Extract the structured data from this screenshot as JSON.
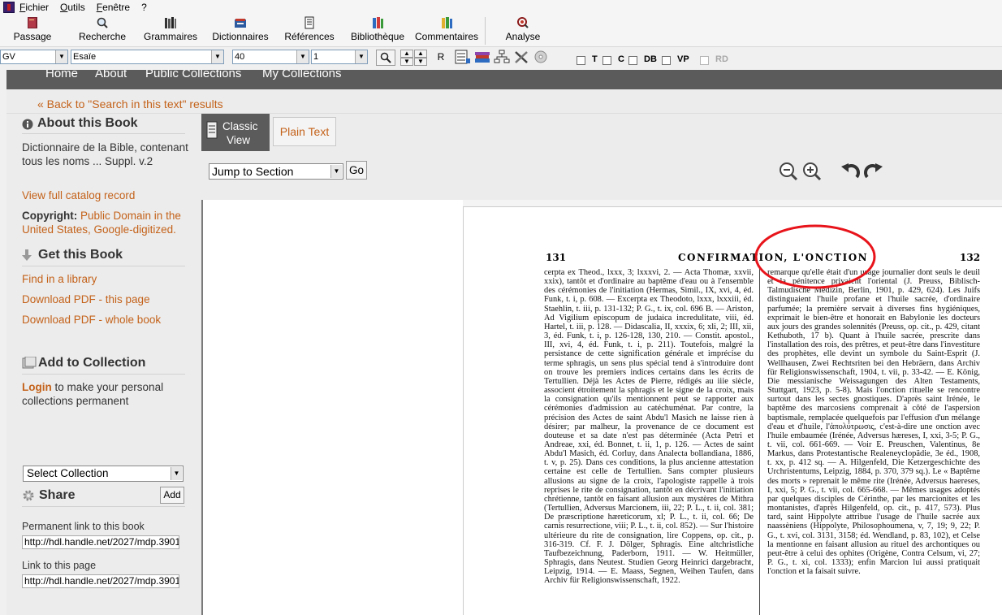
{
  "menu": [
    "Fichier",
    "Outils",
    "Fenêtre",
    "?"
  ],
  "toolbar": [
    {
      "label": "Passage",
      "icon": "book-passage-icon"
    },
    {
      "label": "Recherche",
      "icon": "search-icon"
    },
    {
      "label": "Grammaires",
      "icon": "grammar-books-icon"
    },
    {
      "label": "Dictionnaires",
      "icon": "dictionary-icon"
    },
    {
      "label": "Références",
      "icon": "references-icon"
    },
    {
      "label": "Bibliothèque",
      "icon": "library-icon"
    },
    {
      "label": "Commentaires",
      "icon": "commentary-books-icon"
    },
    {
      "label": "Analyse",
      "icon": "analysis-magnifier-icon"
    }
  ],
  "selectors": {
    "version": "GV",
    "book": "Esaïe",
    "chapter": "40",
    "verse": "1"
  },
  "row2_buttons": {
    "r_label": "R"
  },
  "checkboxes": [
    {
      "label": "T",
      "enabled": true
    },
    {
      "label": "C",
      "enabled": true
    },
    {
      "label": "DB",
      "enabled": true
    },
    {
      "label": "VP",
      "enabled": true
    },
    {
      "label": "RD",
      "enabled": false
    }
  ],
  "web": {
    "nav": [
      "Home",
      "About",
      "Public Collections",
      "My Collections"
    ],
    "back_link": "« Back to \"Search in this text\" results",
    "about": {
      "heading": "About this Book",
      "title": "Dictionnaire de la Bible, contenant tous les noms ... Suppl. v.2",
      "catalog_link": "View full catalog record",
      "copyright_label": "Copyright:",
      "copyright_value": "Public Domain in the United States, Google-digitized."
    },
    "get_book": {
      "heading": "Get this Book",
      "links": [
        "Find in a library",
        "Download PDF - this page",
        "Download PDF - whole book"
      ]
    },
    "collection": {
      "heading": "Add to Collection",
      "login_word": "Login",
      "login_rest": " to make your personal collections permanent",
      "select_value": "Select Collection",
      "add_label": "Add"
    },
    "share": {
      "heading": "Share",
      "permanent_label": "Permanent link to this book",
      "permanent_value": "http://hdl.handle.net/2027/mdp.3901",
      "page_label": "Link to this page",
      "page_value": "http://hdl.handle.net/2027/mdp.3901"
    },
    "views": {
      "classic_line1": "Classic",
      "classic_line2": "View",
      "plain": "Plain Text"
    },
    "jump": {
      "value": "Jump to Section",
      "go_label": "Go"
    },
    "page": {
      "left_num": "131",
      "running_title": "CONFIRMATION, L'ONCTION",
      "right_num": "132",
      "col_left": "cerpta ex Theod., lxxx, 3; lxxxvi, 2. — Acta Thomæ, xxvii, xxix), tantôt et d'ordinaire au baptême d'eau ou à l'ensemble des cérémonies de l'initiation (Hermas, Simil., IX, xvi, 4, éd. Funk, t. i, p. 608. — Excerpta ex Theodoto, lxxx, lxxxiii, éd. Staehlin, t. iii, p. 131-132; P. G., t. ix, col. 696 B. — Ariston, Ad Vigilium episcopum de judaica incredulitate, viii, éd. Hartel, t. iii, p. 128. — Didascalia, II, xxxix, 6; xli, 2; III, xii, 3, éd. Funk, t. i, p. 126-128, 130, 210. — Constit. apostol., III, xvi, 4, éd. Funk, t. i, p. 211). Toutefois, malgré la persistance de cette signification générale et imprécise du terme sphragis, un sens plus spécial tend à s'introduire dont on trouve les premiers indices certains dans les écrits de Tertullien. Déjà les Actes de Pierre, rédigés au iiie siècle, associent étroitement la sphragis et le signe de la croix, mais la consignation qu'ils mentionnent peut se rapporter aux cérémonies d'admission au catéchuménat. Par contre, la précision des Actes de saint Abdu'l Masich ne laisse rien à désirer; par malheur, la provenance de ce document est douteuse et sa date n'est pas déterminée (Acta Petri et Andreae, xxi, éd. Bonnet, t. ii, 1, p. 126. — Actes de saint Abdu'l Masich, éd. Corluy, dans Analecta bollandiana, 1886, t. v, p. 25). Dans ces conditions, la plus ancienne attestation certaine est celle de Tertullien. Sans compter plusieurs allusions au signe de la croix, l'apologiste rappelle à trois reprises le rite de consignation, tantôt en décrivant l'initiation chrétienne, tantôt en faisant allusion aux mystères de Mithra (Tertullien, Adversus Marcionem, iii, 22; P. L., t. ii, col. 381; De præscriptione hæreticorum, xl; P. L., t. ii, col. 66; De carnis resurrectione, viii; P. L., t. ii, col. 852). — Sur l'histoire ultérieure du rite de consignation, lire Coppens, op. cit., p. 316-319. Cf. F. J. Dölger, Sphragis. Eine altchristliche Taufbezeichnung, Paderborn, 1911. — W. Heitmüller, Sphragis, dans Neutest. Studien Georg Heinrici dargebracht, Leipzig, 1914. — E. Maass, Segnen, Weihen Taufen, dans Archiv für Religionswissenschaft, 1922.",
      "col_right": "remarque qu'elle était d'un usage journalier dont seuls le deuil et la pénitence privaient l'oriental (J. Preuss, Biblisch-Talmudische Medizin, Berlin, 1901, p. 429, 624). Les Juifs distinguaient l'huile profane et l'huile sacrée, d'ordinaire parfumée; la première servait à diverses fins hygiéniques, exprimait le bien-être et honorait en Babylonie les docteurs aux jours des grandes solennités (Preuss, op. cit., p. 429, citant Kethuboth, 17 b). Quant à l'huile sacrée, prescrite dans l'installation des rois, des prêtres, et peut-être dans l'investiture des prophètes, elle devint un symbole du Saint-Esprit (J. Wellhausen, Zwei Rechtsriten bei den Hebräern, dans Archiv für Religionswissenschaft, 1904, t. vii, p. 33-42. — E. König, Die messianische Weissagungen des Alten Testaments, Stuttgart, 1923, p. 5-8). Mais l'onction rituelle se rencontre surtout dans les sectes gnostiques. D'après saint Irénée, le baptême des marcosiens comprenait à côté de l'aspersion baptismale, remplacée quelquefois par l'effusion d'un mélange d'eau et d'huile, l'ἀπολύτρωσις, c'est-à-dire une onction avec l'huile embaumée (Irénée, Adversus hæreses, I, xxi, 3-5; P. G., t. vii, col. 661-669. — Voir E. Preuschen, Valentinus, 8e Markus, dans Protestantische Realeneyclopädie, 3e éd., 1908, t. xx, p. 412 sq. — A. Hilgenfeld, Die Ketzergeschichte des Urchristentums, Leipzig, 1884, p. 370, 379 sq.). Le « Baptême des morts » reprenait le même rite (Irénée, Adversus haereses, I, xxi, 5; P. G., t. vii, col. 665-668. — Mêmes usages adoptés par quelques disciples de Cérinthe, par les marcionites et les montanistes, d'après Hilgenfeld, op. cit., p. 417, 573). Plus tard, saint Hippolyte attribue l'usage de l'huile sacrée aux naassèniens (Hippolyte, Philosophoumena, v, 7, 19; 9, 22; P. G., t. xvi, col. 3131, 3158; éd. Wendland, p. 83, 102), et Celse la mentionne en faisant allusion au rituel des archontiques ou peut-être à celui des ophites (Origène, Contra Celsum, vi, 27; P. G., t. xi, col. 1333); enfin Marcion lui aussi pratiquait l'onction et la faisait suivre."
    }
  },
  "colors": {
    "accent_link": "#c4621a",
    "nav_dark": "#5b5b5b",
    "annotation_circle": "#e8141b"
  }
}
